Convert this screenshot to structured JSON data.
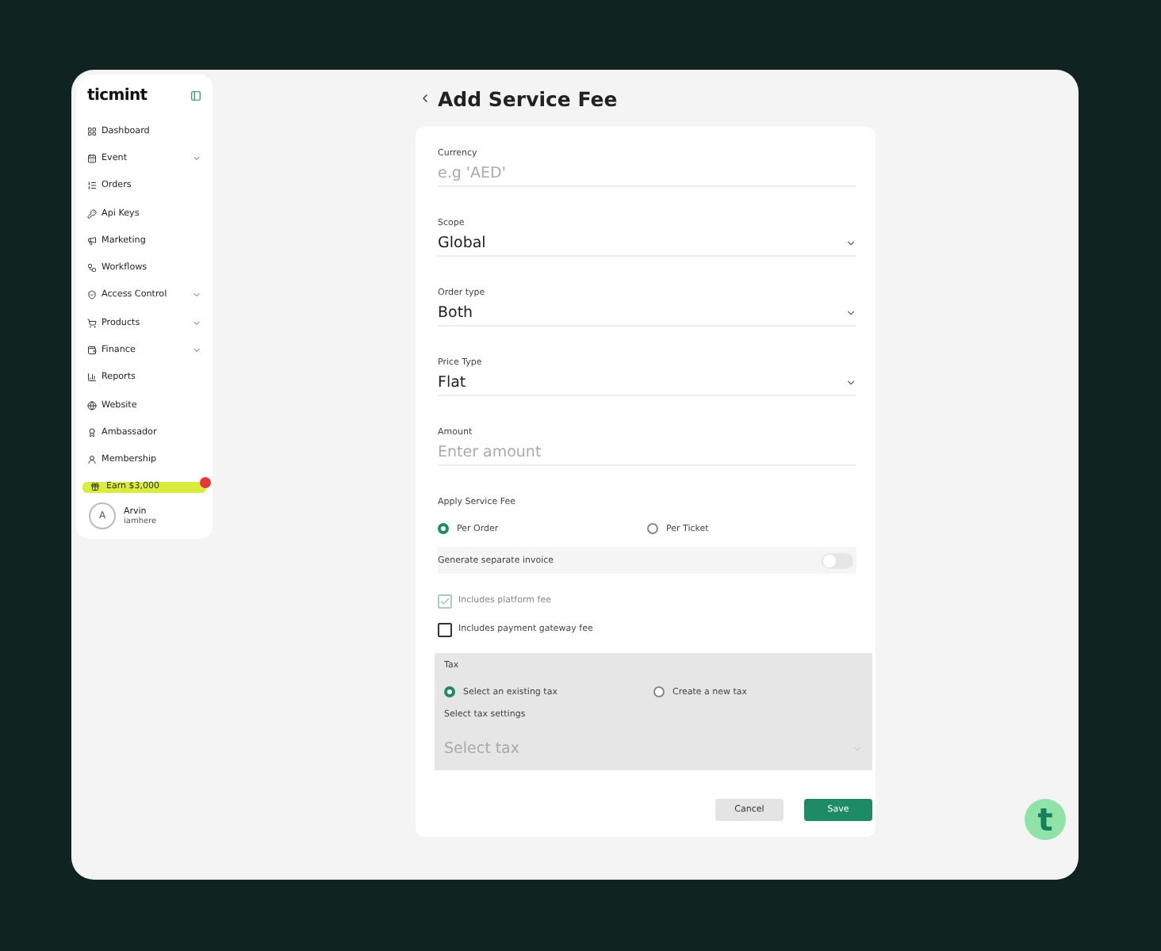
{
  "sidebar": {
    "brand": "ticmint",
    "items": [
      {
        "label": "Dashboard",
        "has_submenu": false
      },
      {
        "label": "Event",
        "has_submenu": true
      },
      {
        "label": "Orders",
        "has_submenu": false
      },
      {
        "label": "Api Keys",
        "has_submenu": false
      },
      {
        "label": "Marketing",
        "has_submenu": false
      },
      {
        "label": "Workflows",
        "has_submenu": false
      },
      {
        "label": "Access Control",
        "has_submenu": true
      },
      {
        "label": "Products",
        "has_submenu": true
      },
      {
        "label": "Finance",
        "has_submenu": true
      },
      {
        "label": "Reports",
        "has_submenu": false
      },
      {
        "label": "Website",
        "has_submenu": false
      },
      {
        "label": "Ambassador",
        "has_submenu": false
      },
      {
        "label": "Membership",
        "has_submenu": false
      }
    ],
    "earn": {
      "label": "Earn $3,000",
      "notification": true
    },
    "user": {
      "initial": "A",
      "name": "Arvin",
      "handle": "iamhere"
    }
  },
  "page": {
    "title": "Add Service Fee"
  },
  "form": {
    "fields": [
      {
        "kind": "input",
        "label": "Currency",
        "placeholder": "e.g 'AED'"
      },
      {
        "kind": "select",
        "label": "Scope",
        "value": "Global"
      },
      {
        "kind": "select",
        "label": "Order type",
        "value": "Both"
      },
      {
        "kind": "select",
        "label": "Price Type",
        "value": "Flat"
      },
      {
        "kind": "input",
        "label": "Amount",
        "placeholder": "Enter amount"
      }
    ],
    "apply_fee": {
      "label": "Apply Service Fee",
      "options": [
        {
          "label": "Per Order",
          "selected": true
        },
        {
          "label": "Per Ticket",
          "selected": false
        }
      ]
    },
    "invoice": {
      "label": "Generate separate invoice",
      "on": false
    },
    "checkboxes": [
      {
        "label": "Includes platform fee",
        "checked": true,
        "disabled": true
      },
      {
        "label": "Includes payment gateway fee",
        "checked": false,
        "disabled": false
      }
    ],
    "tax": {
      "label": "Tax",
      "options": [
        {
          "label": "Select an existing tax",
          "selected": true
        },
        {
          "label": "Create a new tax",
          "selected": false
        }
      ],
      "settings_label": "Select tax settings",
      "placeholder": "Select tax",
      "disabled": true
    },
    "buttons": [
      {
        "label": "Cancel",
        "kind": "secondary"
      },
      {
        "label": "Save",
        "kind": "primary"
      }
    ]
  },
  "chat": {
    "letter": "t"
  }
}
